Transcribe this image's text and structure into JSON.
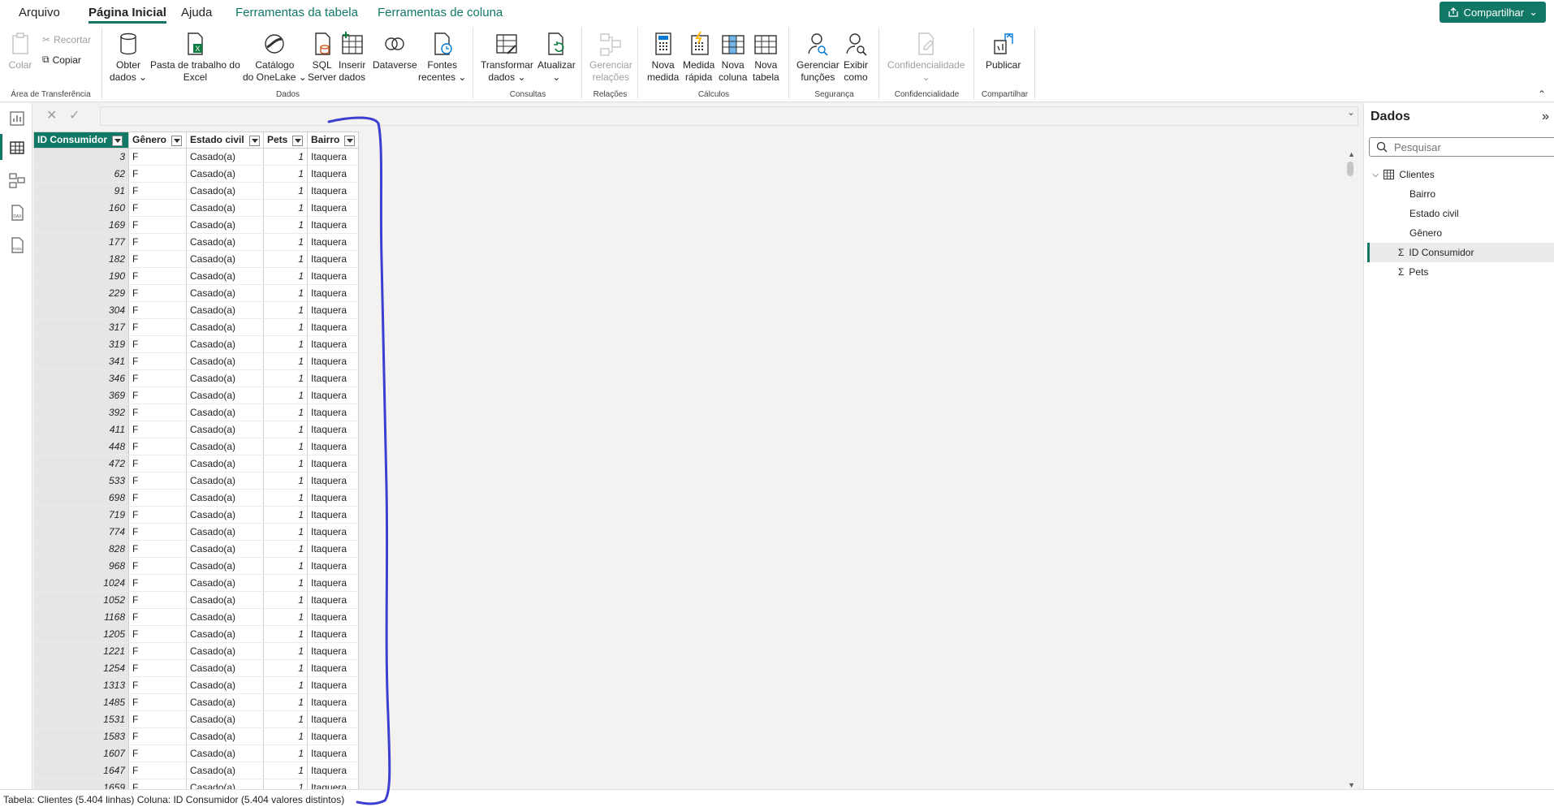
{
  "tabs": {
    "file": "Arquivo",
    "home": "Página Inicial",
    "help": "Ajuda",
    "table_tools": "Ferramentas da tabela",
    "column_tools": "Ferramentas de coluna"
  },
  "share_label": "Compartilhar",
  "ribbon": {
    "clipboard": {
      "paste": "Colar",
      "cut": "Recortar",
      "copy": "Copiar",
      "label": "Área de Transferência"
    },
    "data": {
      "get_data": [
        "Obter",
        "dados"
      ],
      "excel": [
        "Pasta de trabalho do",
        "Excel"
      ],
      "onelake": [
        "Catálogo",
        "do OneLake"
      ],
      "sql": [
        "SQL",
        "Server"
      ],
      "enter": [
        "Inserir",
        "dados"
      ],
      "dataverse": [
        "Dataverse",
        ""
      ],
      "recent": [
        "Fontes",
        "recentes"
      ],
      "label": "Dados"
    },
    "queries": {
      "transform": [
        "Transformar",
        "dados"
      ],
      "refresh": [
        "Atualizar",
        ""
      ],
      "label": "Consultas"
    },
    "relations": {
      "manage": [
        "Gerenciar",
        "relações"
      ],
      "label": "Relações"
    },
    "calc": {
      "new_measure": [
        "Nova",
        "medida"
      ],
      "quick_measure": [
        "Medida",
        "rápida"
      ],
      "new_column": [
        "Nova",
        "coluna"
      ],
      "new_table": [
        "Nova",
        "tabela"
      ],
      "label": "Cálculos"
    },
    "security": {
      "manage_roles": [
        "Gerenciar",
        "funções"
      ],
      "view_as": [
        "Exibir",
        "como"
      ],
      "label": "Segurança"
    },
    "sensitivity": {
      "btn": "Confidencialidade",
      "label": "Confidencialidade"
    },
    "share": {
      "publish": "Publicar",
      "label": "Compartilhar"
    }
  },
  "table": {
    "columns": [
      "ID Consumidor",
      "Gênero",
      "Estado civil",
      "Pets",
      "Bairro"
    ],
    "rows": [
      [
        "3",
        "F",
        "Casado(a)",
        "1",
        "Itaquera"
      ],
      [
        "62",
        "F",
        "Casado(a)",
        "1",
        "Itaquera"
      ],
      [
        "91",
        "F",
        "Casado(a)",
        "1",
        "Itaquera"
      ],
      [
        "160",
        "F",
        "Casado(a)",
        "1",
        "Itaquera"
      ],
      [
        "169",
        "F",
        "Casado(a)",
        "1",
        "Itaquera"
      ],
      [
        "177",
        "F",
        "Casado(a)",
        "1",
        "Itaquera"
      ],
      [
        "182",
        "F",
        "Casado(a)",
        "1",
        "Itaquera"
      ],
      [
        "190",
        "F",
        "Casado(a)",
        "1",
        "Itaquera"
      ],
      [
        "229",
        "F",
        "Casado(a)",
        "1",
        "Itaquera"
      ],
      [
        "304",
        "F",
        "Casado(a)",
        "1",
        "Itaquera"
      ],
      [
        "317",
        "F",
        "Casado(a)",
        "1",
        "Itaquera"
      ],
      [
        "319",
        "F",
        "Casado(a)",
        "1",
        "Itaquera"
      ],
      [
        "341",
        "F",
        "Casado(a)",
        "1",
        "Itaquera"
      ],
      [
        "346",
        "F",
        "Casado(a)",
        "1",
        "Itaquera"
      ],
      [
        "369",
        "F",
        "Casado(a)",
        "1",
        "Itaquera"
      ],
      [
        "392",
        "F",
        "Casado(a)",
        "1",
        "Itaquera"
      ],
      [
        "411",
        "F",
        "Casado(a)",
        "1",
        "Itaquera"
      ],
      [
        "448",
        "F",
        "Casado(a)",
        "1",
        "Itaquera"
      ],
      [
        "472",
        "F",
        "Casado(a)",
        "1",
        "Itaquera"
      ],
      [
        "533",
        "F",
        "Casado(a)",
        "1",
        "Itaquera"
      ],
      [
        "698",
        "F",
        "Casado(a)",
        "1",
        "Itaquera"
      ],
      [
        "719",
        "F",
        "Casado(a)",
        "1",
        "Itaquera"
      ],
      [
        "774",
        "F",
        "Casado(a)",
        "1",
        "Itaquera"
      ],
      [
        "828",
        "F",
        "Casado(a)",
        "1",
        "Itaquera"
      ],
      [
        "968",
        "F",
        "Casado(a)",
        "1",
        "Itaquera"
      ],
      [
        "1024",
        "F",
        "Casado(a)",
        "1",
        "Itaquera"
      ],
      [
        "1052",
        "F",
        "Casado(a)",
        "1",
        "Itaquera"
      ],
      [
        "1168",
        "F",
        "Casado(a)",
        "1",
        "Itaquera"
      ],
      [
        "1205",
        "F",
        "Casado(a)",
        "1",
        "Itaquera"
      ],
      [
        "1221",
        "F",
        "Casado(a)",
        "1",
        "Itaquera"
      ],
      [
        "1254",
        "F",
        "Casado(a)",
        "1",
        "Itaquera"
      ],
      [
        "1313",
        "F",
        "Casado(a)",
        "1",
        "Itaquera"
      ],
      [
        "1485",
        "F",
        "Casado(a)",
        "1",
        "Itaquera"
      ],
      [
        "1531",
        "F",
        "Casado(a)",
        "1",
        "Itaquera"
      ],
      [
        "1583",
        "F",
        "Casado(a)",
        "1",
        "Itaquera"
      ],
      [
        "1607",
        "F",
        "Casado(a)",
        "1",
        "Itaquera"
      ],
      [
        "1647",
        "F",
        "Casado(a)",
        "1",
        "Itaquera"
      ],
      [
        "1659",
        "F",
        "Casado(a)",
        "1",
        "Itaquera"
      ]
    ]
  },
  "pane": {
    "title": "Dados",
    "search_placeholder": "Pesquisar",
    "table_name": "Clientes",
    "fields": [
      "Bairro",
      "Estado civil",
      "Gênero",
      "ID Consumidor",
      "Pets"
    ]
  },
  "status": "Tabela: Clientes (5.404 linhas) Coluna: ID Consumidor (5.404 valores distintos)",
  "colors": {
    "accent": "#117865",
    "annotation": "#3b3fd1"
  }
}
